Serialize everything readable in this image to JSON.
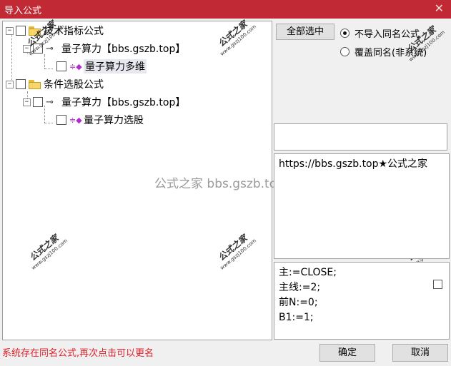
{
  "window": {
    "title": "导入公式",
    "close_icon": "close-icon"
  },
  "tree": {
    "items": [
      {
        "label": "技术指标公式",
        "icon": "folder-icon",
        "expander": "−",
        "checked": false
      },
      {
        "label": "量子算力【bbs.gszb.top】",
        "icon": "key-icon",
        "expander": "−",
        "checked": false
      },
      {
        "label": "量子算力多维",
        "icon": "formula-icon",
        "checked": false,
        "selected": true
      },
      {
        "label": "条件选股公式",
        "icon": "folder-icon",
        "expander": "−",
        "checked": false
      },
      {
        "label": "量子算力【bbs.gszb.top】",
        "icon": "key-icon",
        "expander": "−",
        "checked": false
      },
      {
        "label": "量子算力选股",
        "icon": "formula-icon",
        "checked": false
      }
    ]
  },
  "watermark": {
    "center_text": "公式之家 bbs.gszb.top",
    "stamp_cn": "公式之家",
    "stamp_url": "www.gszj100.com"
  },
  "options": {
    "select_all_label": "全部选中",
    "radio_skip_label": "不导入同名公式",
    "radio_overwrite_label": "覆盖同名(非系统)",
    "selected_radio": "skip"
  },
  "description_text": "https://bbs.gszb.top★公式之家",
  "code_lines": [
    "主:=CLOSE;",
    "主线:=2;",
    "前N:=0;",
    "B1:=1;"
  ],
  "status_message": "系统存在同名公式,再次点击可以更名",
  "buttons": {
    "ok_label": "确定",
    "cancel_label": "取消"
  }
}
